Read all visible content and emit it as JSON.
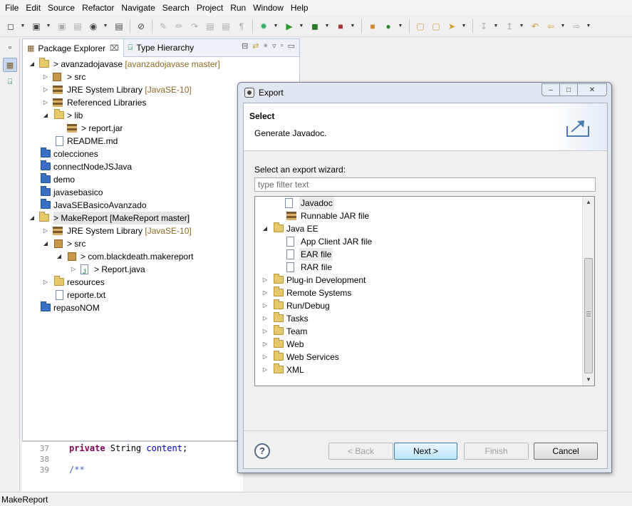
{
  "menu": [
    "File",
    "Edit",
    "Source",
    "Refactor",
    "Navigate",
    "Search",
    "Project",
    "Run",
    "Window",
    "Help"
  ],
  "views": {
    "package_explorer": "Package Explorer",
    "type_hierarchy": "Type Hierarchy"
  },
  "tree": [
    {
      "label": "> avanzadojavase",
      "decoration": " [avanzadojavase master]"
    },
    {
      "label": "> src"
    },
    {
      "label": "JRE System Library",
      "decoration": " [JavaSE-10]"
    },
    {
      "label": "Referenced Libraries"
    },
    {
      "label": "> lib"
    },
    {
      "label": "> report.jar"
    },
    {
      "label": "README.md"
    },
    {
      "label": "colecciones"
    },
    {
      "label": "connectNodeJSJava"
    },
    {
      "label": "demo"
    },
    {
      "label": "javasebasico"
    },
    {
      "label": "JavaSEBasicoAvanzado"
    },
    {
      "label": "> MakeReport [MakeReport master]"
    },
    {
      "label": "JRE System Library",
      "decoration": " [JavaSE-10]"
    },
    {
      "label": "> src"
    },
    {
      "label": "> com.blackdeath.makereport"
    },
    {
      "label": "> Report.java"
    },
    {
      "label": "resources"
    },
    {
      "label": "reporte.txt"
    },
    {
      "label": "repasoNOM"
    }
  ],
  "editor": {
    "lines": [
      {
        "num": "37",
        "kw": "private",
        "type": " String ",
        "field": "content",
        "rest": ";"
      },
      {
        "num": "38"
      },
      {
        "num": "39",
        "comment": "/**"
      }
    ]
  },
  "status": "MakeReport",
  "dialog": {
    "title": "Export",
    "heading": "Select",
    "description": "Generate Javadoc.",
    "wizard_label": "Select an export wizard:",
    "filter_placeholder": "type filter text",
    "list": [
      {
        "label": "Javadoc"
      },
      {
        "label": "Runnable JAR file"
      },
      {
        "label": "Java EE"
      },
      {
        "label": "App Client JAR file"
      },
      {
        "label": "EAR file"
      },
      {
        "label": "RAR file"
      },
      {
        "label": "Plug-in Development"
      },
      {
        "label": "Remote Systems"
      },
      {
        "label": "Run/Debug"
      },
      {
        "label": "Tasks"
      },
      {
        "label": "Team"
      },
      {
        "label": "Web"
      },
      {
        "label": "Web Services"
      },
      {
        "label": "XML"
      }
    ],
    "buttons": {
      "help": "?",
      "back": "< Back",
      "next": "Next >",
      "finish": "Finish",
      "cancel": "Cancel"
    }
  }
}
